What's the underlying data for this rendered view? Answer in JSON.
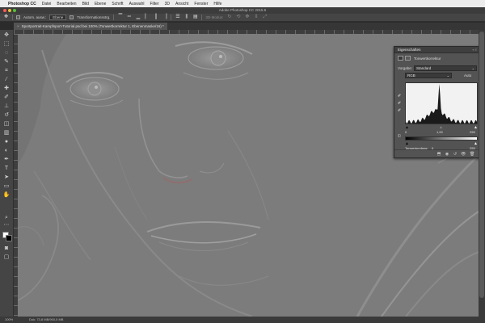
{
  "menubar": {
    "apple": "",
    "app_name": "Photoshop CC",
    "items": [
      "Datei",
      "Bearbeiten",
      "Bild",
      "Ebene",
      "Schrift",
      "Auswahl",
      "Filter",
      "3D",
      "Ansicht",
      "Fenster",
      "Hilfe"
    ]
  },
  "window": {
    "title": "Adobe Photoshop CC 2015.5"
  },
  "options_bar": {
    "auto_select_label": "Autom. ausw.:",
    "auto_select_value": "Ebene",
    "transform_label": "Transformationsstrg.",
    "mode_3d_label": "3D-Modus:"
  },
  "document_tab": {
    "close": "×",
    "label": "Sportportrait-Kampfsport-Tutorial.psd bei 100% (Tonwertkorrektur 1, Ebenenmaske/16) *"
  },
  "properties_panel": {
    "title": "Eigenschaften",
    "controls": "« ≡",
    "adjustment_name": "Tonwertkorrektur",
    "preset_label": "Vorgabe:",
    "preset_value": "Standard",
    "channel_value": "RGB",
    "auto_label": "Auto",
    "input_black": "0",
    "input_gamma": "1,00",
    "input_white": "255",
    "output_label": "Tonwertumfang:",
    "output_black": "0",
    "output_white": "255",
    "histogram_peak_level": 120
  },
  "status_bar": {
    "zoom": "100%",
    "doc_info": "Dok: 73,8 MB/900,5 MB"
  },
  "colors": {
    "accent": "#3a7bd5",
    "close": "#fc5b57",
    "minimize": "#e5bf3c",
    "maximize": "#57c038"
  }
}
